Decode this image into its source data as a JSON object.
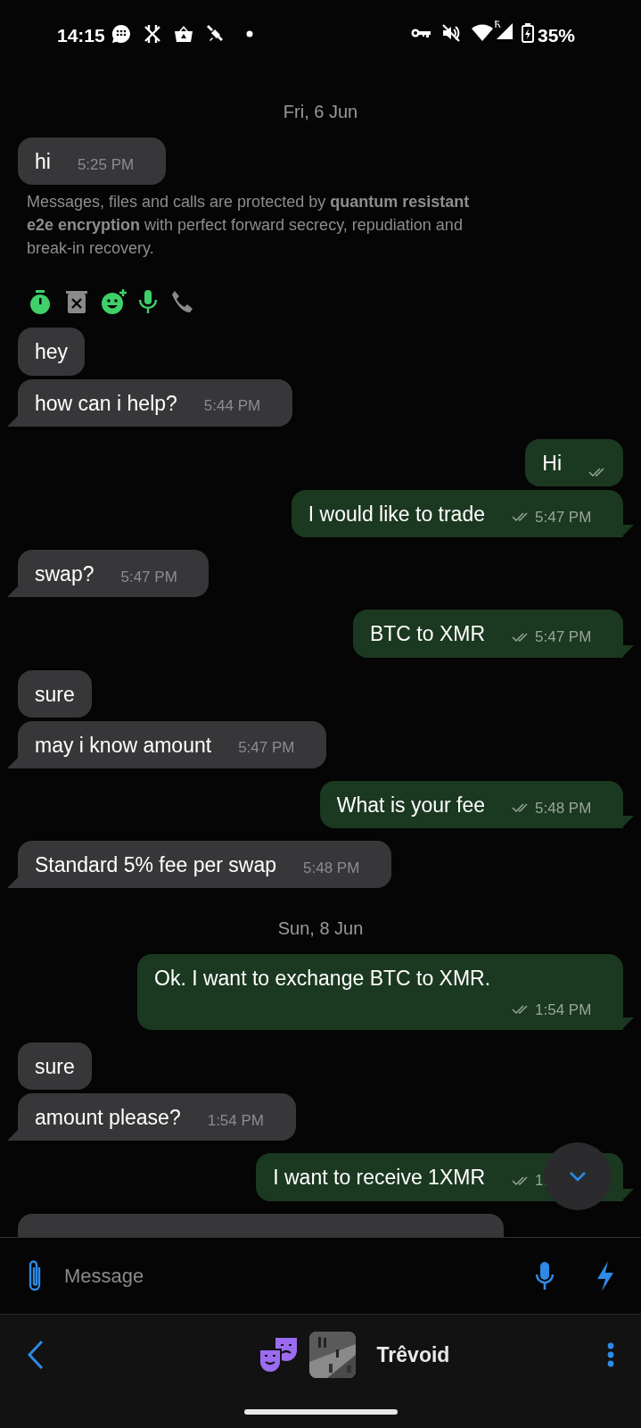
{
  "status_bar": {
    "time": "14:15",
    "battery": "35%"
  },
  "messages": [
    {
      "kind": "date",
      "text": "Fri, 6 Jun"
    },
    {
      "kind": "message",
      "outgoing": false,
      "text": "hi",
      "time": "5:25 PM",
      "tail": false
    },
    {
      "kind": "notice",
      "text": "Messages, files and calls are protected by **quantum resistant e2e encryption** with perfect forward secrecy, repudiation and break-in recovery."
    },
    {
      "kind": "features",
      "items": [
        {
          "kind": "timer",
          "on": true
        },
        {
          "kind": "delete",
          "on": false
        },
        {
          "kind": "reactions",
          "on": true
        },
        {
          "kind": "voice",
          "on": true
        },
        {
          "kind": "calls",
          "on": false
        }
      ]
    },
    {
      "kind": "message",
      "outgoing": false,
      "text": "hey",
      "tail": false
    },
    {
      "kind": "message",
      "outgoing": false,
      "text": "how can i help?",
      "time": "5:44 PM",
      "tail": true
    },
    {
      "kind": "message",
      "outgoing": true,
      "text": "Hi",
      "tail": false
    },
    {
      "kind": "message",
      "outgoing": true,
      "text": "I would like to trade",
      "time": "5:47 PM",
      "tail": true
    },
    {
      "kind": "message",
      "outgoing": false,
      "text": "swap?",
      "time": "5:47 PM",
      "tail": true
    },
    {
      "kind": "message",
      "outgoing": true,
      "text": "BTC to XMR",
      "time": "5:47 PM",
      "tail": true
    },
    {
      "kind": "message",
      "outgoing": false,
      "text": "sure",
      "tail": false
    },
    {
      "kind": "message",
      "outgoing": false,
      "text": "may i know amount",
      "time": "5:47 PM",
      "tail": true
    },
    {
      "kind": "message",
      "outgoing": true,
      "text": "What is your fee",
      "time": "5:48 PM",
      "tail": true
    },
    {
      "kind": "message",
      "outgoing": false,
      "text": "Standard 5% fee per swap",
      "time": "5:48 PM",
      "tail": true
    },
    {
      "kind": "date",
      "text": "Sun, 8 Jun"
    },
    {
      "kind": "message",
      "outgoing": true,
      "text": "Ok. I want to exchange BTC to XMR.",
      "time": "1:54 PM",
      "tail": true
    },
    {
      "kind": "message",
      "outgoing": false,
      "text": "sure",
      "tail": false
    },
    {
      "kind": "message",
      "outgoing": false,
      "text": "amount please?",
      "time": "1:54 PM",
      "tail": true
    },
    {
      "kind": "message",
      "outgoing": true,
      "text": "I want to receive 1XMR",
      "time": "1:",
      "tail": true
    },
    {
      "kind": "message",
      "outgoing": false
    }
  ],
  "compose": {
    "placeholder": "Message"
  },
  "header": {
    "name": "Trêvoid"
  }
}
